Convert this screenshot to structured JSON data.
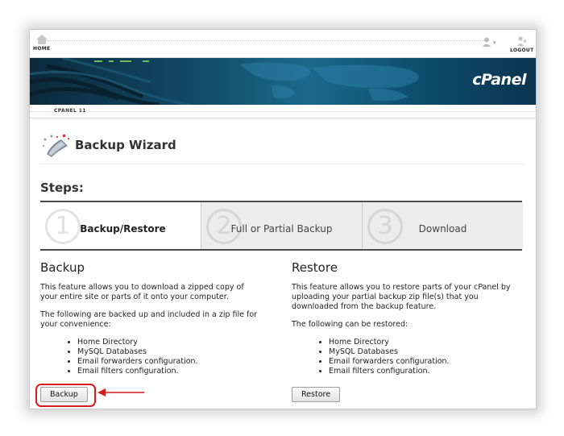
{
  "topbar": {
    "home_label": "HOME",
    "logout_label": "LOGOUT",
    "icons": [
      "home-icon",
      "user-icon",
      "logout-icon"
    ]
  },
  "banner": {
    "brand": "cPanel",
    "version_tag": "CPANEL 11"
  },
  "wizard": {
    "title": "Backup Wizard",
    "steps_heading": "Steps:",
    "steps": [
      {
        "number": "1",
        "label": "Backup/Restore",
        "active": true
      },
      {
        "number": "2",
        "label": "Full or Partial Backup",
        "active": false
      },
      {
        "number": "3",
        "label": "Download",
        "active": false
      }
    ]
  },
  "backup": {
    "heading": "Backup",
    "description": "This feature allows you to download a zipped copy of your entire site or parts of it onto your computer.",
    "intro": "The following are backed up and included in a zip file for your convenience:",
    "items": [
      "Home Directory",
      "MySQL Databases",
      "Email forwarders configuration.",
      "Email filters configuration."
    ],
    "button_label": "Backup"
  },
  "restore": {
    "heading": "Restore",
    "description": "This feature allows you to restore parts of your cPanel by uploading your partial backup zip file(s) that you downloaded from the backup feature.",
    "intro": "The following can be restored:",
    "items": [
      "Home Directory",
      "MySQL Databases",
      "Email forwarders configuration.",
      "Email filters configuration."
    ],
    "button_label": "Restore"
  },
  "colors": {
    "highlight": "#d81c1c",
    "banner": "#114764"
  }
}
